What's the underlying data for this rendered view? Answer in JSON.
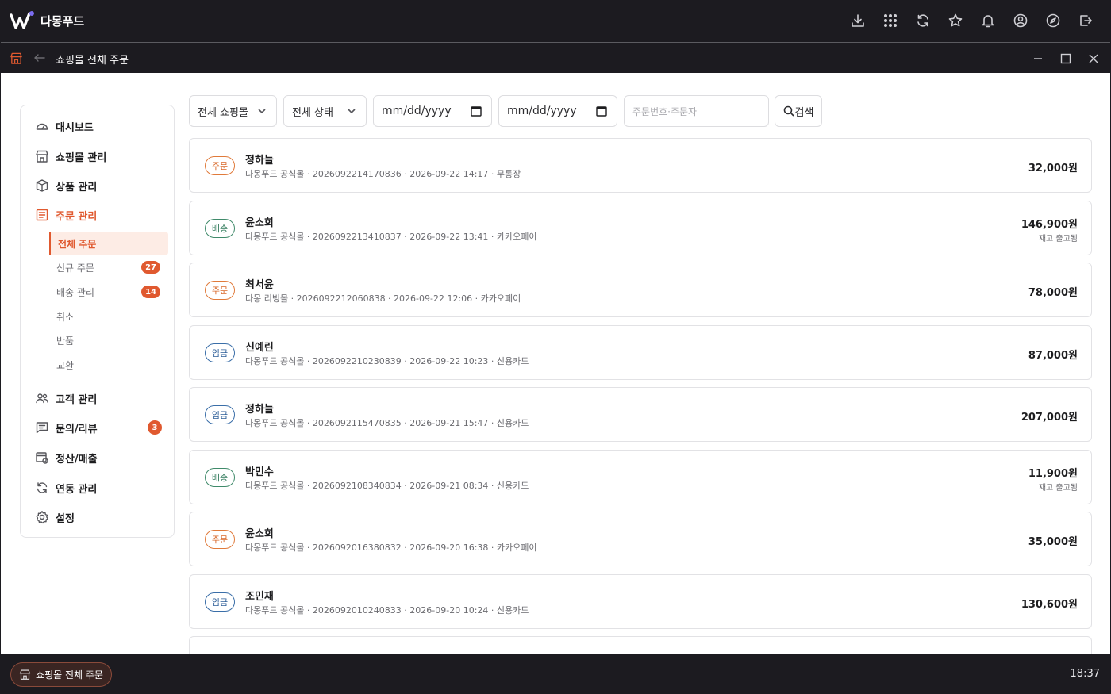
{
  "app": {
    "title": "다몽푸드"
  },
  "window": {
    "title": "쇼핑몰 전체 주문"
  },
  "sidebar": {
    "items": [
      {
        "label": "대시보드",
        "icon": "gauge-icon"
      },
      {
        "label": "쇼핑몰 관리",
        "icon": "store-icon"
      },
      {
        "label": "상품 관리",
        "icon": "box-icon"
      },
      {
        "label": "주문 관리",
        "icon": "order-list-icon",
        "active": true
      },
      {
        "label": "고객 관리",
        "icon": "users-icon"
      },
      {
        "label": "문의/리뷰",
        "icon": "chat-icon",
        "badge": "3"
      },
      {
        "label": "정산/매출",
        "icon": "settlement-icon"
      },
      {
        "label": "연동 관리",
        "icon": "sync-icon"
      },
      {
        "label": "설정",
        "icon": "gear-icon"
      }
    ],
    "sub_items": [
      {
        "label": "전체 주문",
        "active": true
      },
      {
        "label": "신규 주문",
        "badge": "27"
      },
      {
        "label": "배송 관리",
        "badge": "14"
      },
      {
        "label": "취소"
      },
      {
        "label": "반품"
      },
      {
        "label": "교환"
      }
    ]
  },
  "filters": {
    "mall": "전체 쇼핑몰",
    "status": "전체 상태",
    "date_from": "mm/dd/yyyy",
    "date_to": "mm/dd/yyyy",
    "search_placeholder": "주문번호·주문자",
    "search_button": "검색"
  },
  "orders": [
    {
      "status": "주문",
      "customer": "정하늘",
      "meta": "다몽푸드 공식몰 · 2026092214170836 · 2026-09-22 14:17 · 무통장",
      "amount": "32,000원",
      "note": ""
    },
    {
      "status": "배송",
      "customer": "윤소희",
      "meta": "다몽푸드 공식몰 · 2026092213410837 · 2026-09-22 13:41 · 카카오페이",
      "amount": "146,900원",
      "note": "재고 출고됨"
    },
    {
      "status": "주문",
      "customer": "최서윤",
      "meta": "다몽 리빙몰 · 2026092212060838 · 2026-09-22 12:06 · 카카오페이",
      "amount": "78,000원",
      "note": ""
    },
    {
      "status": "입금",
      "customer": "신예린",
      "meta": "다몽푸드 공식몰 · 2026092210230839 · 2026-09-22 10:23 · 신용카드",
      "amount": "87,000원",
      "note": ""
    },
    {
      "status": "입금",
      "customer": "정하늘",
      "meta": "다몽푸드 공식몰 · 2026092115470835 · 2026-09-21 15:47 · 신용카드",
      "amount": "207,000원",
      "note": ""
    },
    {
      "status": "배송",
      "customer": "박민수",
      "meta": "다몽푸드 공식몰 · 2026092108340834 · 2026-09-21 08:34 · 신용카드",
      "amount": "11,900원",
      "note": "재고 출고됨"
    },
    {
      "status": "주문",
      "customer": "윤소희",
      "meta": "다몽푸드 공식몰 · 2026092016380832 · 2026-09-20 16:38 · 카카오페이",
      "amount": "35,000원",
      "note": ""
    },
    {
      "status": "입금",
      "customer": "조민재",
      "meta": "다몽푸드 공식몰 · 2026092010240833 · 2026-09-20 10:24 · 신용카드",
      "amount": "130,600원",
      "note": ""
    }
  ],
  "taskbar": {
    "active_window": "쇼핑몰 전체 주문",
    "time": "18:37"
  },
  "colors": {
    "accent": "#e0592f",
    "order": "#d8682a",
    "ship": "#2f7a5a",
    "pay": "#2d5e98"
  }
}
